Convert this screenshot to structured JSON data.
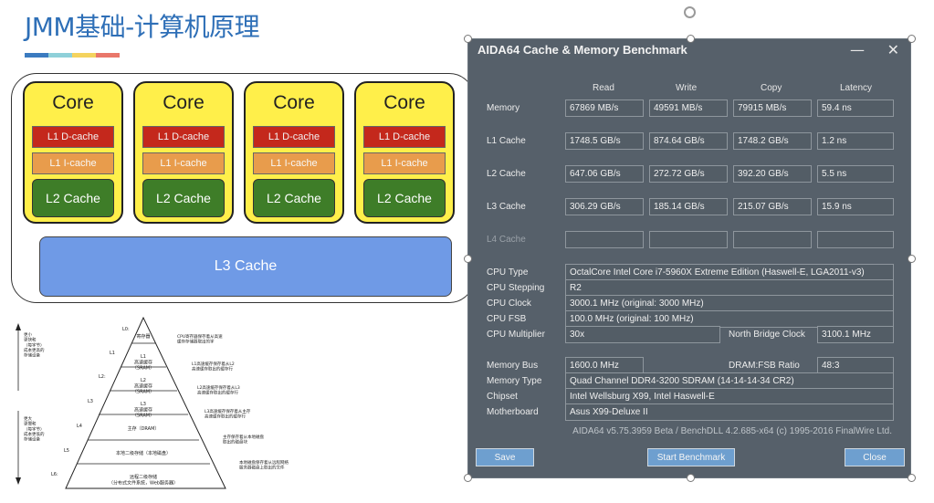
{
  "slide": {
    "title": "JMM基础-计算机原理",
    "stripe_colors": [
      "#3b7bc0",
      "#8fd0d9",
      "#f4d35e",
      "#e9776a"
    ]
  },
  "cpu_diagram": {
    "cores": [
      {
        "label": "Core",
        "l1d": "L1 D-cache",
        "l1i": "L1 I-cache",
        "l2": "L2 Cache"
      },
      {
        "label": "Core",
        "l1d": "L1 D-cache",
        "l1i": "L1 I-cache",
        "l2": "L2 Cache"
      },
      {
        "label": "Core",
        "l1d": "L1 D-cache",
        "l1i": "L1 I-cache",
        "l2": "L2 Cache"
      },
      {
        "label": "Core",
        "l1d": "L1 D-cache",
        "l1i": "L1 I-cache",
        "l2": "L2 Cache"
      }
    ],
    "l3": "L3 Cache"
  },
  "pyramid": {
    "levels": [
      {
        "tag": "L0:",
        "text": "寄存器"
      },
      {
        "tag": "L1",
        "text": "L1\n高速缓存\n（SRAM）"
      },
      {
        "tag": "L2:",
        "text": "L2\n高速缓存\n（SRAM）"
      },
      {
        "tag": "L3",
        "text": "L3\n高速缓存\n（SRAM）"
      },
      {
        "tag": "L4",
        "text": "主存（DRAM）"
      },
      {
        "tag": "L5",
        "text": "本地二级存储（本地磁盘）"
      },
      {
        "tag": "L6:",
        "text": "远程二级存储\n（分布式文件系统，Web服务器）"
      }
    ],
    "notes": [
      "CPU寄存器保存着从高速\n缓存存储器取出的字",
      "L1高速缓存保存着从L2\n高速缓存取出的缓存行",
      "L2高速缓存保存着从L3\n高速缓存取出的缓存行",
      "L3高速缓存保存着从主存\n高速缓存取出的缓存行",
      "主存保存着从本地磁盘\n取出的磁盘块",
      "本地磁盘保存着从远程网络\n服务器磁盘上取出的文件"
    ],
    "left_top": "更小\n更快和\n（每字节）\n成本更高的\n存储设备",
    "left_bottom": "更大\n更慢和\n（每字节）\n成本更低的\n存储设备"
  },
  "aida": {
    "title": "AIDA64 Cache & Memory Benchmark",
    "minimize": "—",
    "close": "✕",
    "columns": [
      "Read",
      "Write",
      "Copy",
      "Latency"
    ],
    "rows": [
      {
        "label": "Memory",
        "values": [
          "67869 MB/s",
          "49591 MB/s",
          "79915 MB/s",
          "59.4 ns"
        ],
        "dim": false
      },
      {
        "label": "L1 Cache",
        "values": [
          "1748.5 GB/s",
          "874.64 GB/s",
          "1748.2 GB/s",
          "1.2 ns"
        ],
        "dim": false
      },
      {
        "label": "L2 Cache",
        "values": [
          "647.06 GB/s",
          "272.72 GB/s",
          "392.20 GB/s",
          "5.5 ns"
        ],
        "dim": false
      },
      {
        "label": "L3 Cache",
        "values": [
          "306.29 GB/s",
          "185.14 GB/s",
          "215.07 GB/s",
          "15.9 ns"
        ],
        "dim": false
      },
      {
        "label": "L4 Cache",
        "values": [
          "",
          "",
          "",
          ""
        ],
        "dim": true
      }
    ],
    "info": {
      "cpu_type_label": "CPU Type",
      "cpu_type": "OctalCore Intel Core i7-5960X Extreme Edition  (Haswell-E, LGA2011-v3)",
      "cpu_stepping_label": "CPU Stepping",
      "cpu_stepping": "R2",
      "cpu_clock_label": "CPU Clock",
      "cpu_clock": "3000.1 MHz  (original: 3000 MHz)",
      "cpu_fsb_label": "CPU FSB",
      "cpu_fsb": "100.0 MHz  (original: 100 MHz)",
      "cpu_mult_label": "CPU Multiplier",
      "cpu_mult": "30x",
      "nb_clock_label": "North Bridge Clock",
      "nb_clock": "3100.1 MHz",
      "mem_bus_label": "Memory Bus",
      "mem_bus": "1600.0 MHz",
      "dram_fsb_label": "DRAM:FSB Ratio",
      "dram_fsb": "48:3",
      "mem_type_label": "Memory Type",
      "mem_type": "Quad Channel DDR4-3200 SDRAM  (14-14-14-34 CR2)",
      "chipset_label": "Chipset",
      "chipset": "Intel Wellsburg X99, Intel Haswell-E",
      "mobo_label": "Motherboard",
      "mobo": "Asus X99-Deluxe II"
    },
    "footer": "AIDA64 v5.75.3959 Beta / BenchDLL 4.2.685-x64  (c) 1995-2016 FinalWire Ltd.",
    "buttons": {
      "save": "Save",
      "start": "Start Benchmark",
      "close": "Close"
    }
  }
}
